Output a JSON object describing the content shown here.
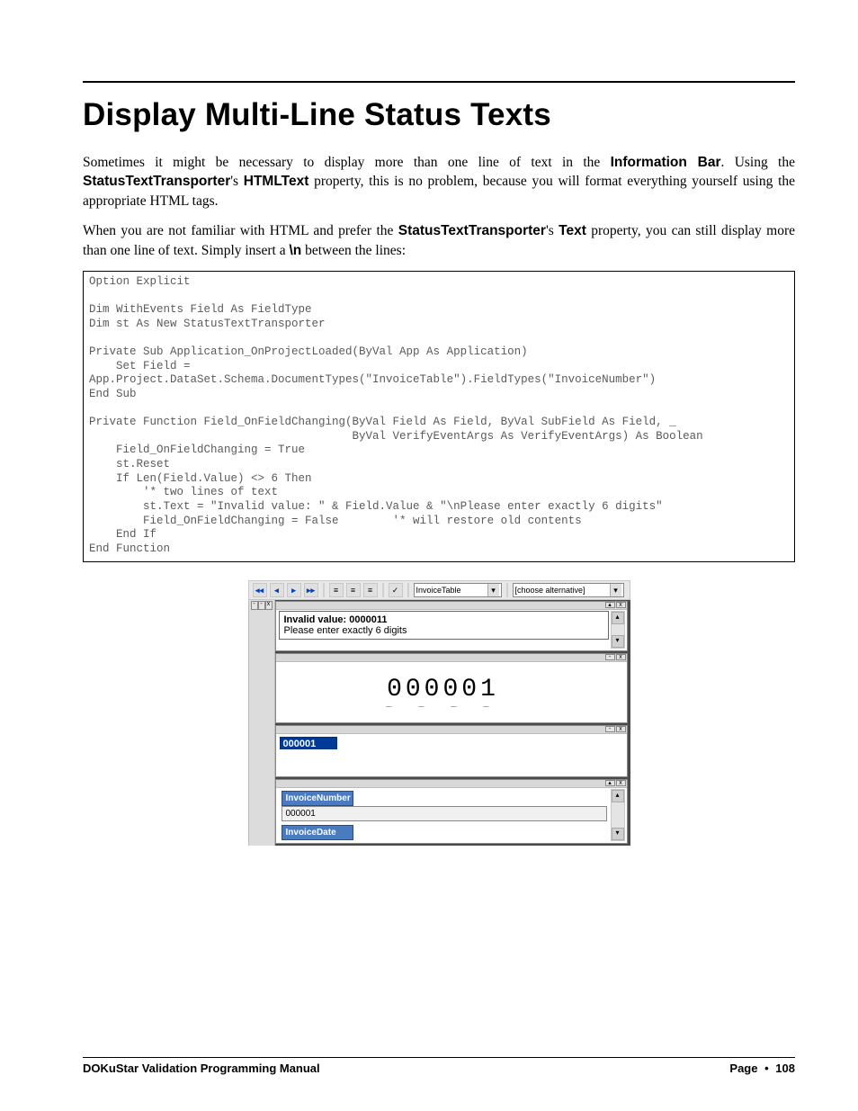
{
  "title": "Display Multi-Line Status Texts",
  "para1": {
    "p1a": "Sometimes it might be necessary to display more than one line of text in the ",
    "info_bar": "Information Bar",
    "p1b": ". Using the ",
    "stt": "StatusTextTransporter",
    "p1c": "'s ",
    "html_text": "HTMLText",
    "p1d": " property, this is no problem, because you will format everything yourself using the appropriate HTML tags."
  },
  "para2": {
    "p2a": "When you are not familiar with HTML and prefer the ",
    "stt": "StatusTextTransporter",
    "p2b": "'s ",
    "text_prop": "Text",
    "p2c": " property, you can still display more than one line of text. Simply insert a ",
    "newline_tok": "\\n",
    "p2d": " between the lines:"
  },
  "code": "Option Explicit\n\nDim WithEvents Field As FieldType\nDim st As New StatusTextTransporter\n\nPrivate Sub Application_OnProjectLoaded(ByVal App As Application)\n    Set Field =\nApp.Project.DataSet.Schema.DocumentTypes(\"InvoiceTable\").FieldTypes(\"InvoiceNumber\")\nEnd Sub\n\nPrivate Function Field_OnFieldChanging(ByVal Field As Field, ByVal SubField As Field, _\n                                       ByVal VerifyEventArgs As VerifyEventArgs) As Boolean\n    Field_OnFieldChanging = True\n    st.Reset\n    If Len(Field.Value) <> 6 Then\n        '* two lines of text\n        st.Text = \"Invalid value: \" & Field.Value & \"\\nPlease enter exactly 6 digits\"\n        Field_OnFieldChanging = False        '* will restore old contents\n    End If\nEnd Function",
  "app": {
    "toolbar": {
      "nav_first": "◂◂",
      "nav_prev": "◂",
      "nav_next": "▸",
      "nav_last": "▸▸",
      "align1": "≡",
      "align2": "≡",
      "align3": "≡",
      "check": "✓",
      "combo1": "InvoiceTable",
      "combo2": "[choose alternative]",
      "dd": "▾"
    },
    "msg": {
      "line1": "Invalid value: 0000011",
      "line2": "Please enter exactly 6 digits"
    },
    "img_value": "000001",
    "input_value": "000001",
    "fields": {
      "f1_name": "InvoiceNumber",
      "f1_val": "000001",
      "f2_name": "InvoiceDate"
    },
    "scroll_up": "▴",
    "scroll_down": "▾",
    "win_btn_up": "▴",
    "win_btn_x": "x"
  },
  "footer": {
    "left": "DOKuStar Validation Programming Manual",
    "page_label": "Page",
    "bullet": "•",
    "page_num": "108"
  }
}
